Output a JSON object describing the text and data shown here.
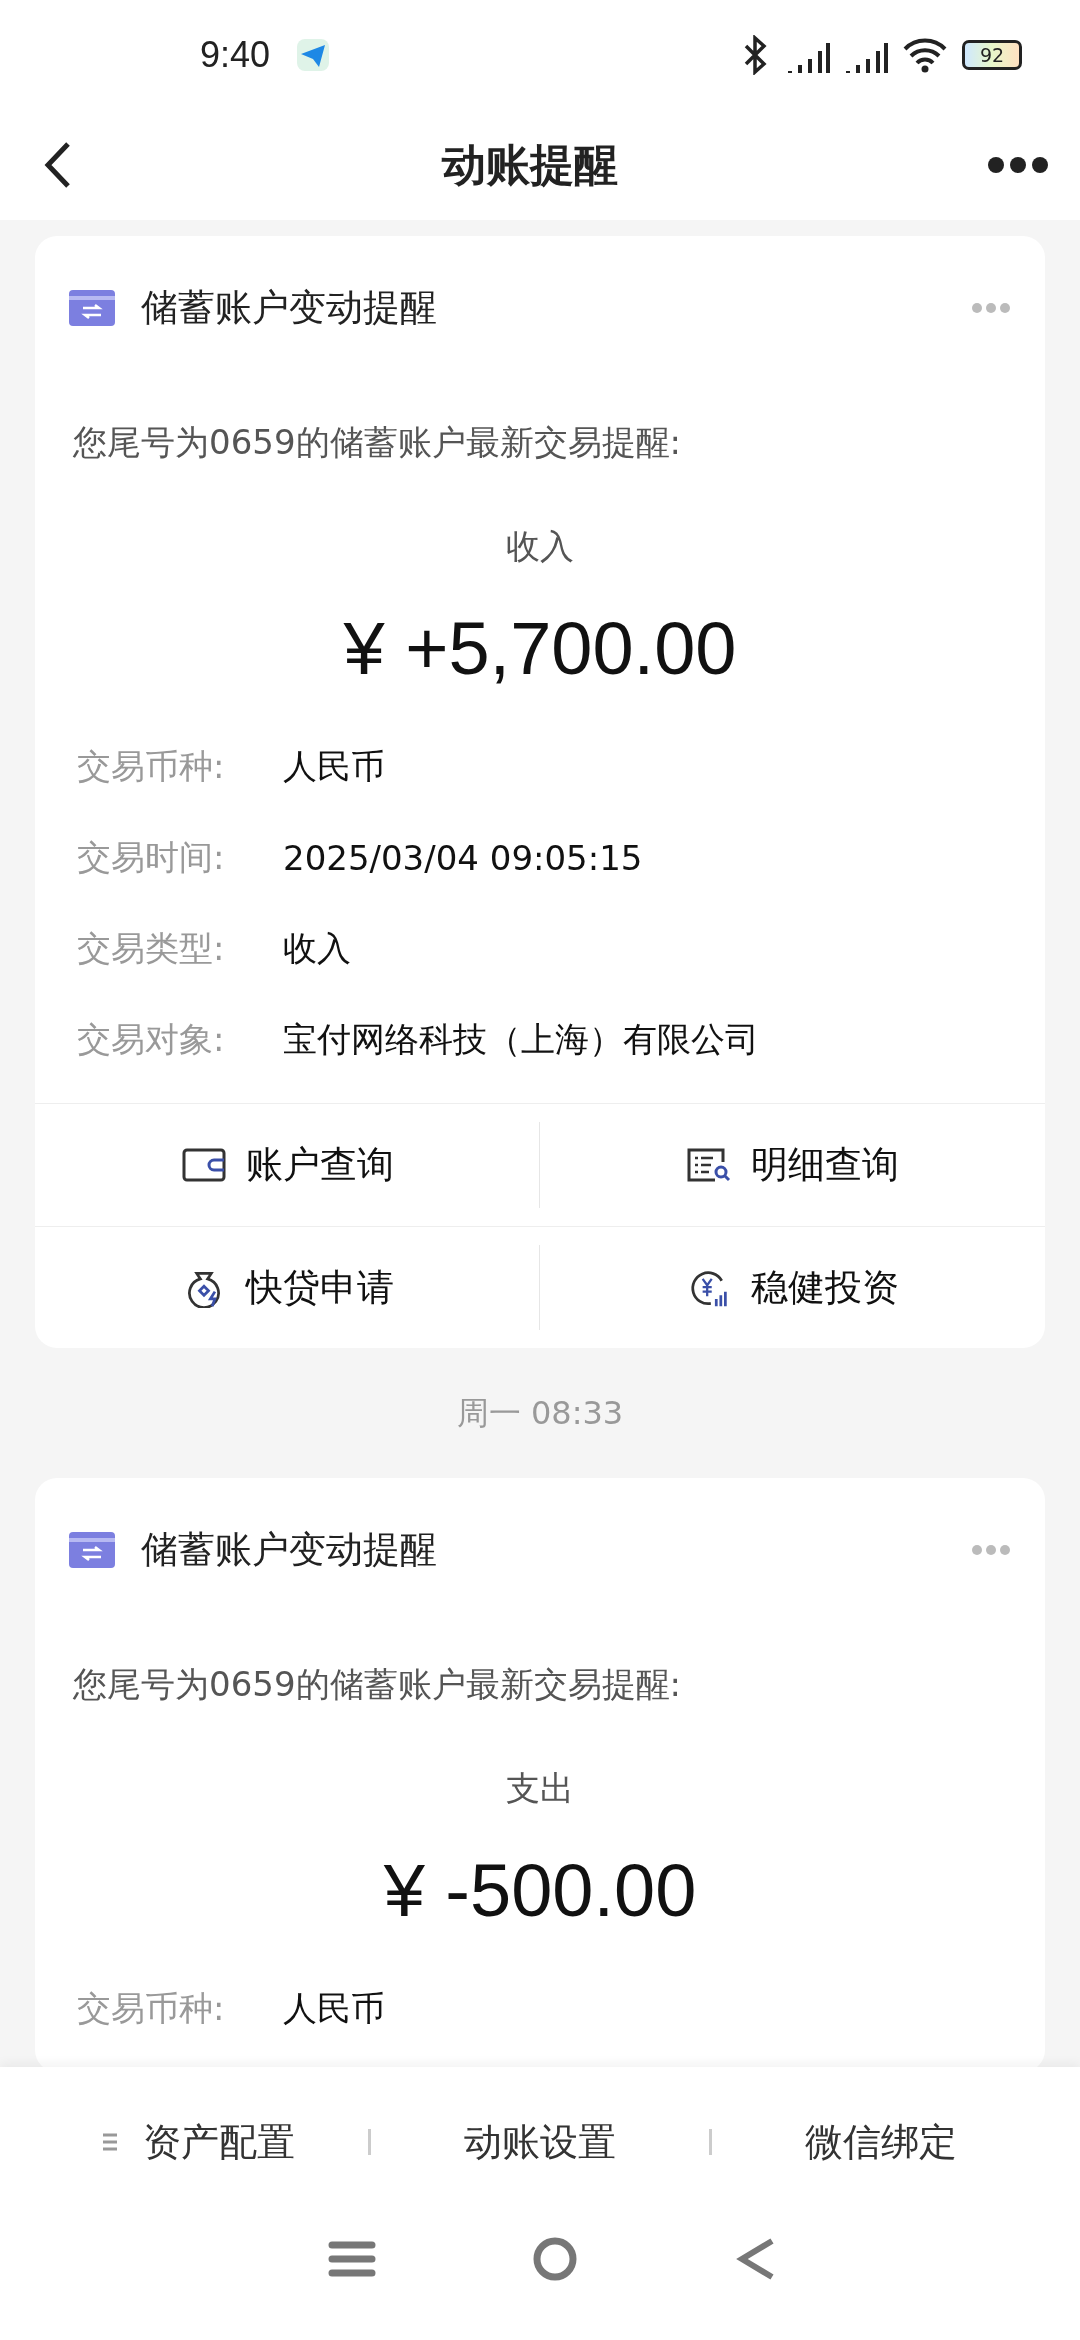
{
  "status_bar": {
    "time": "9:40",
    "battery": "92"
  },
  "nav": {
    "title": "动账提醒"
  },
  "feed": [
    {
      "kind": "card",
      "title": "储蓄账户变动提醒",
      "intro": "您尾号为0659的储蓄账户最新交易提醒:",
      "direction": "收入",
      "amount": "¥ +5,700.00",
      "fields": [
        {
          "label": "交易币种:",
          "value": "人民币"
        },
        {
          "label": "交易时间:",
          "value": "2025/03/04 09:05:15"
        },
        {
          "label": "交易类型:",
          "value": "收入"
        },
        {
          "label": "交易对象:",
          "value": "宝付网络科技（上海）有限公司"
        }
      ],
      "actions": [
        {
          "kind": "wallet",
          "label": "账户查询"
        },
        {
          "kind": "statement",
          "label": "明细查询"
        },
        {
          "kind": "loan",
          "label": "快贷申请"
        },
        {
          "kind": "invest",
          "label": "稳健投资"
        }
      ]
    },
    {
      "kind": "time",
      "text": "周一 08:33"
    },
    {
      "kind": "card",
      "title": "储蓄账户变动提醒",
      "intro": "您尾号为0659的储蓄账户最新交易提醒:",
      "direction": "支出",
      "amount": "¥ -500.00",
      "fields": [
        {
          "label": "交易币种:",
          "value": "人民币"
        }
      ]
    }
  ],
  "bottom_menu": [
    {
      "label": "资产配置",
      "submenu": true
    },
    {
      "label": "动账设置",
      "submenu": false
    },
    {
      "label": "微信绑定",
      "submenu": false
    }
  ]
}
